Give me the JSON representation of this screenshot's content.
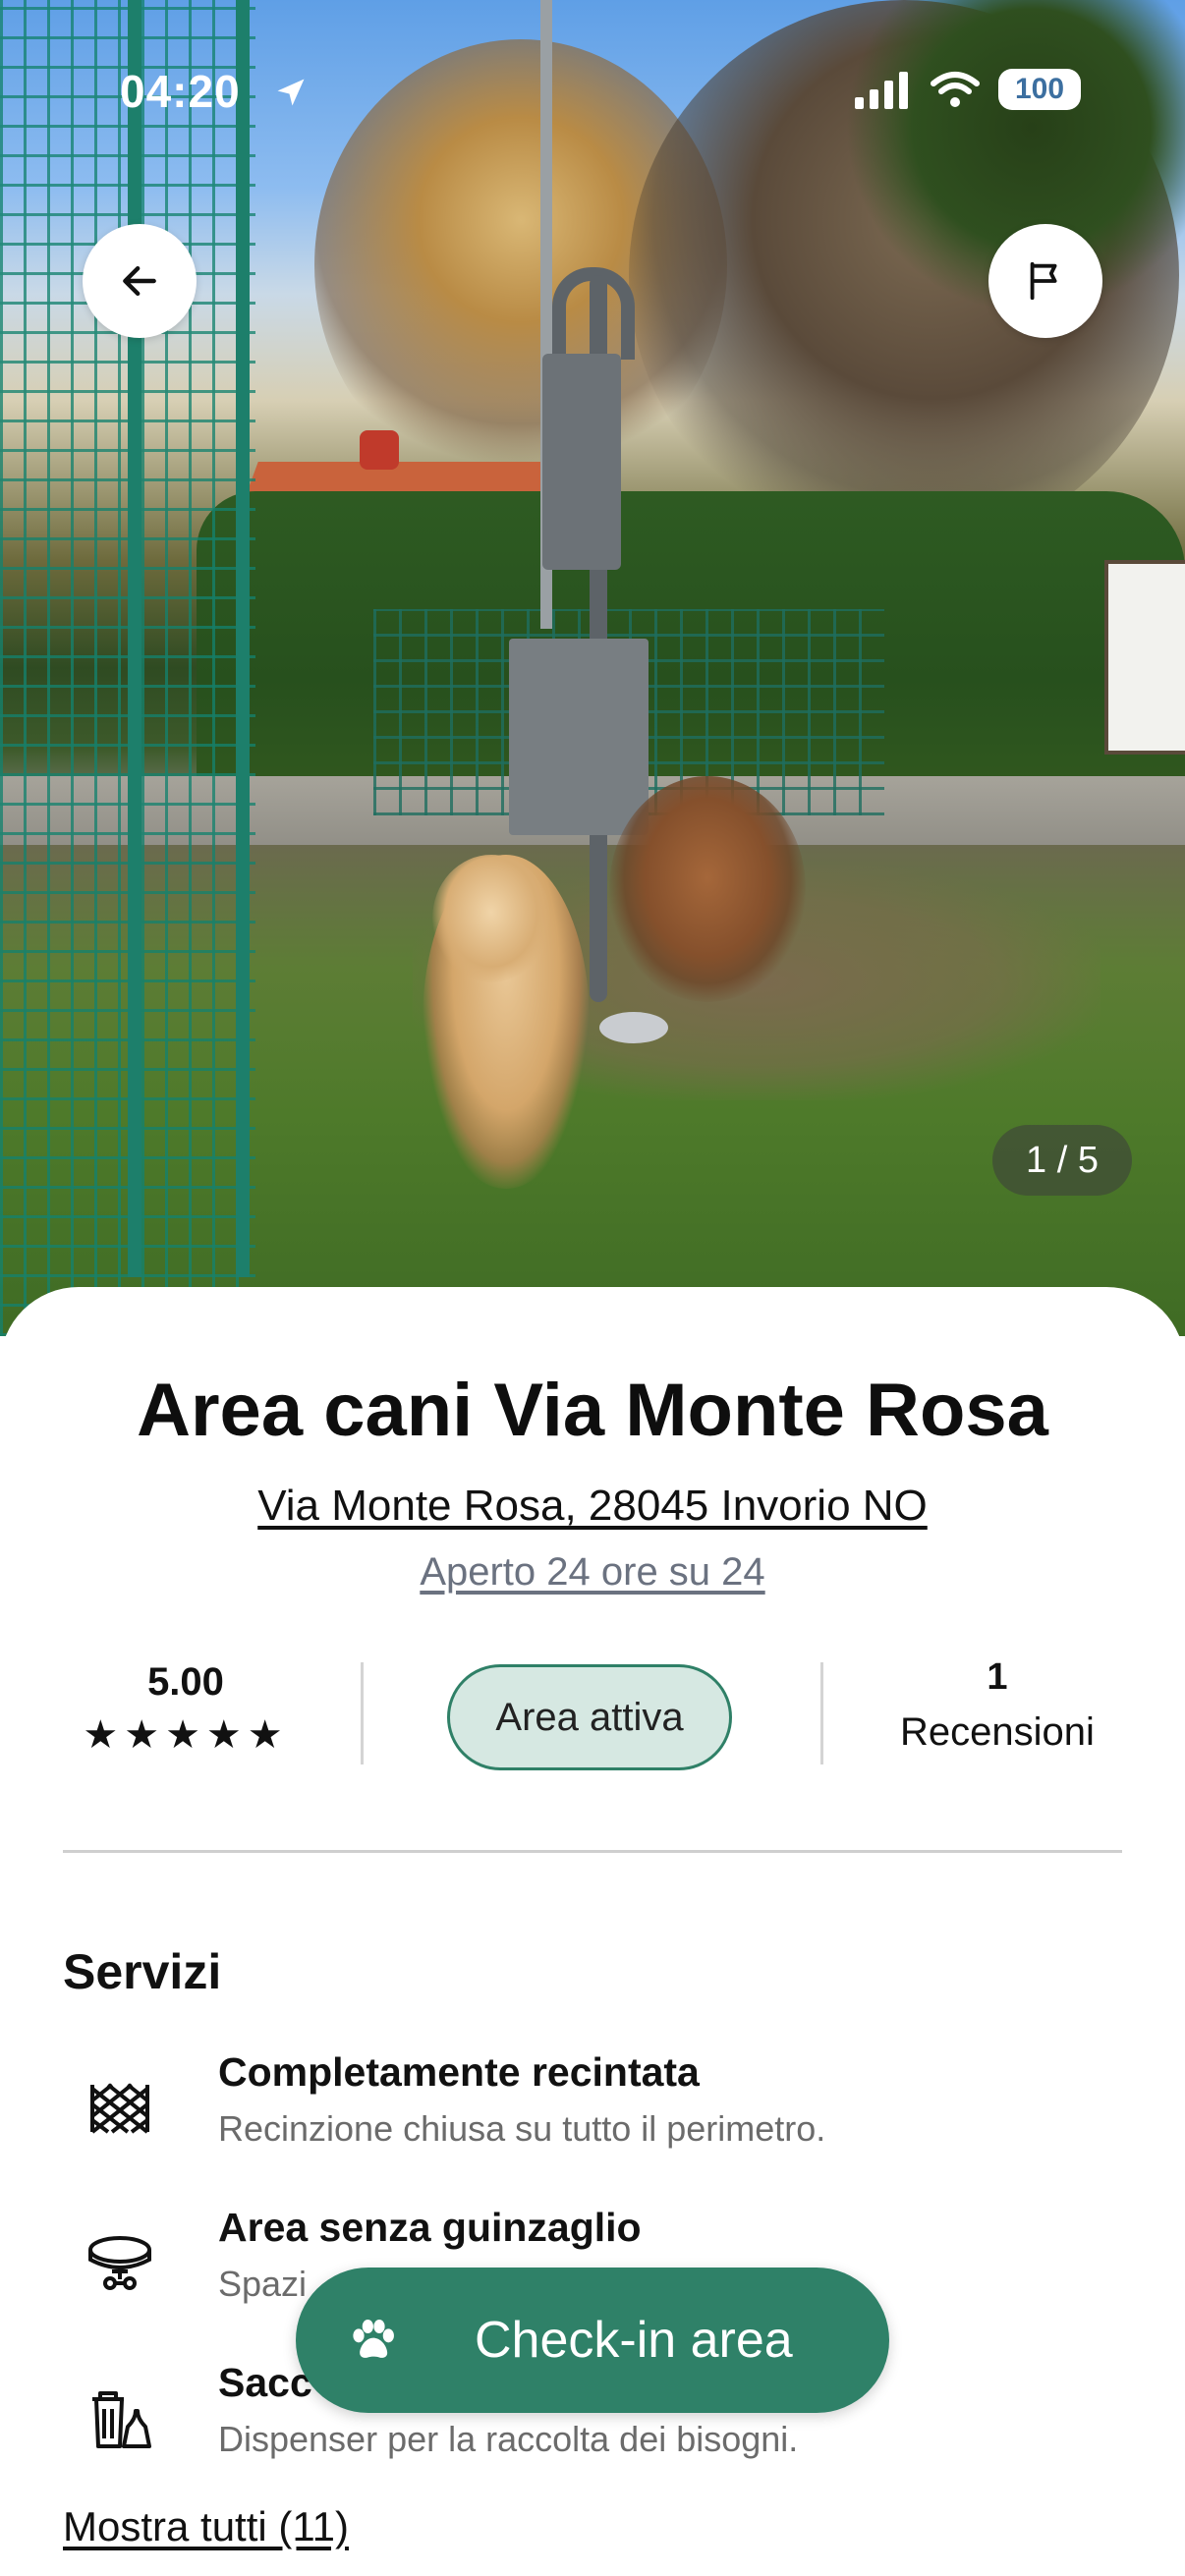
{
  "status_bar": {
    "time": "04:20",
    "battery": "100",
    "icons": [
      "location-arrow-icon",
      "signal-icon",
      "wifi-icon",
      "battery-icon"
    ]
  },
  "hero": {
    "photo_counter": "1 / 5",
    "buttons": {
      "back": "back-arrow-icon",
      "report": "flag-icon"
    }
  },
  "place": {
    "name": "Area cani Via Monte Rosa",
    "address": "Via Monte Rosa, 28045 Invorio NO",
    "hours": "Aperto 24 ore su 24"
  },
  "stats": {
    "rating": "5.00",
    "stars": "★★★★★",
    "status": "Area attiva",
    "reviews_count": "1",
    "reviews_label": "Recensioni"
  },
  "services": {
    "title": "Servizi",
    "items": [
      {
        "title": "Completamente recintata",
        "description": "Recinzione chiusa su tutto il perimetro.",
        "icon": "fence-icon"
      },
      {
        "title": "Area senza guinzaglio",
        "description": "Spazi",
        "icon": "dog-collar-icon"
      },
      {
        "title": "Sacc",
        "description": "Dispenser per la raccolta dei bisogni.",
        "icon": "bag-dispenser-icon"
      }
    ],
    "show_all": "Mostra tutti (11)"
  },
  "checkin_button": {
    "label": "Check-in area",
    "icon": "paw-icon"
  },
  "colors": {
    "accent": "#2f8168",
    "pill_bg": "#d6e8e2",
    "muted_text": "#6b7280"
  }
}
